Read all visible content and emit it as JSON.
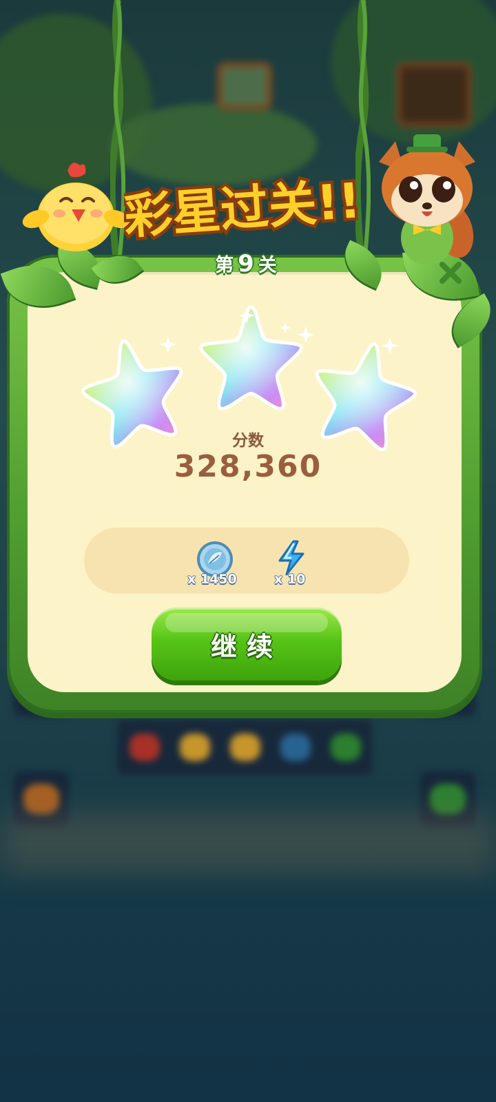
{
  "header": {
    "title": "彩星过关!!"
  },
  "dialog": {
    "level_prefix": "第",
    "level_number": "9",
    "level_suffix": "关",
    "stars_earned": 3,
    "stars_total": 3,
    "score_label": "分数",
    "score_value": "328,360",
    "rewards": [
      {
        "icon": "coin-icon",
        "count": "x 1450"
      },
      {
        "icon": "energy-bolt-icon",
        "count": "x 10"
      }
    ],
    "continue_label": "继续",
    "close_icon": "close-icon"
  },
  "colors": {
    "panel_bg": "#fcf3c8",
    "panel_frame": "#4f9c30",
    "score_text": "#9a5e3e",
    "button_green": "#56c416"
  }
}
